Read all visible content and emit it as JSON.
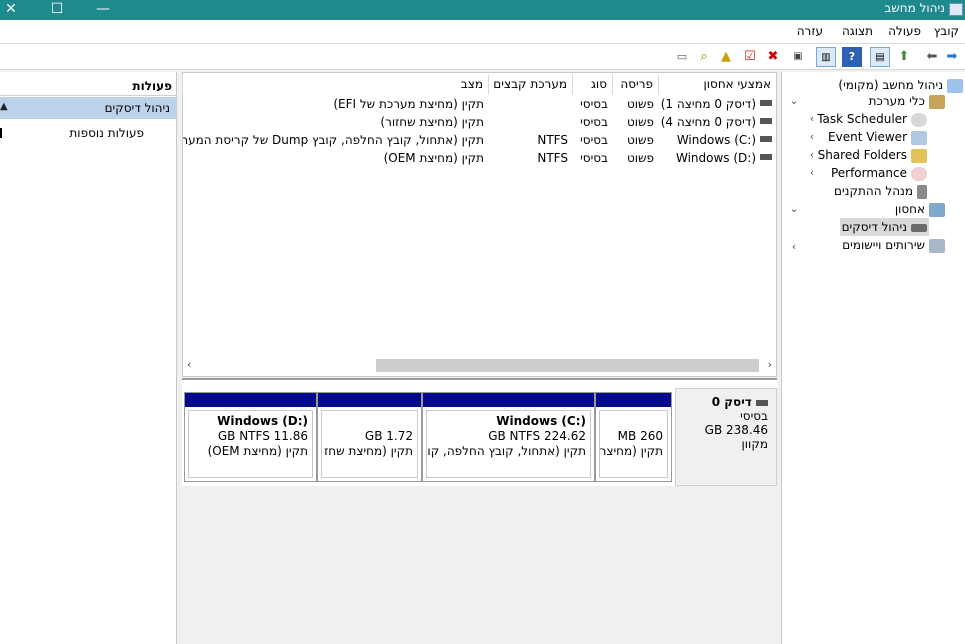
{
  "window": {
    "title": "ניהול מחשב",
    "minimize_glyph": "—",
    "maximize_glyph": "☐",
    "close_glyph": "✕"
  },
  "menu": {
    "items": [
      "קובץ",
      "פעולה",
      "תצוגה",
      "עזרה"
    ]
  },
  "toolbar": {
    "icons": [
      "back-icon",
      "forward-icon",
      "up-icon",
      "show-hide-tree-icon",
      "help-icon",
      "list-view-icon",
      "connect-icon",
      "delete-icon",
      "check-icon",
      "properties-icon",
      "search-icon",
      "export-icon"
    ]
  },
  "tree": {
    "root": "ניהול מחשב (מקומי)",
    "system_tools": "כלי מערכת",
    "task_scheduler": "Task Scheduler",
    "event_viewer": "Event Viewer",
    "shared_folders": "Shared Folders",
    "performance": "Performance",
    "device_manager": "מנהל ההתקנים",
    "storage": "אחסון",
    "disk_management": "ניהול דיסקים",
    "services": "שירותים ויישומים"
  },
  "volume_table": {
    "headers": {
      "volume": "אמצעי אחסון",
      "layout": "פריסה",
      "type": "סוג",
      "filesystem": "מערכת קבצים",
      "status": "מצב"
    },
    "rows": [
      {
        "volume": "(דיסק 0 מחיצה 1)",
        "layout": "פשוט",
        "type": "בסיסי",
        "filesystem": "",
        "status": "תקין (מחיצת מערכת של EFI)"
      },
      {
        "volume": "(דיסק 0 מחיצה 4)",
        "layout": "פשוט",
        "type": "בסיסי",
        "filesystem": "",
        "status": "תקין (מחיצת שחזור)"
      },
      {
        "volume": "Windows (C:)",
        "layout": "פשוט",
        "type": "בסיסי",
        "filesystem": "NTFS",
        "status": "תקין (אתחול, קובץ החלפה, קובץ Dump של קריסת המער"
      },
      {
        "volume": "Windows (D:)",
        "layout": "פשוט",
        "type": "בסיסי",
        "filesystem": "NTFS",
        "status": "תקין (מחיצת OEM)"
      }
    ]
  },
  "disk0": {
    "name": "דיסק 0",
    "type": "בסיסי",
    "size": "238.46 GB",
    "state": "מקוון",
    "partitions": [
      {
        "title": "",
        "size": "260 MB",
        "status": "תקין (מחיצר"
      },
      {
        "title": "Windows  (C:)",
        "size": "224.62 GB NTFS",
        "status": "תקין (אתחול, קובץ החלפה, קו"
      },
      {
        "title": "",
        "size": "1.72 GB",
        "status": "תקין (מחיצת שחז"
      },
      {
        "title": "Windows  (D:)",
        "size": "11.86 GB NTFS",
        "status": "תקין (מחיצת OEM)"
      }
    ]
  },
  "actions": {
    "header": "פעולות",
    "section": "ניהול דיסקים",
    "more": "פעולות נוספות"
  }
}
